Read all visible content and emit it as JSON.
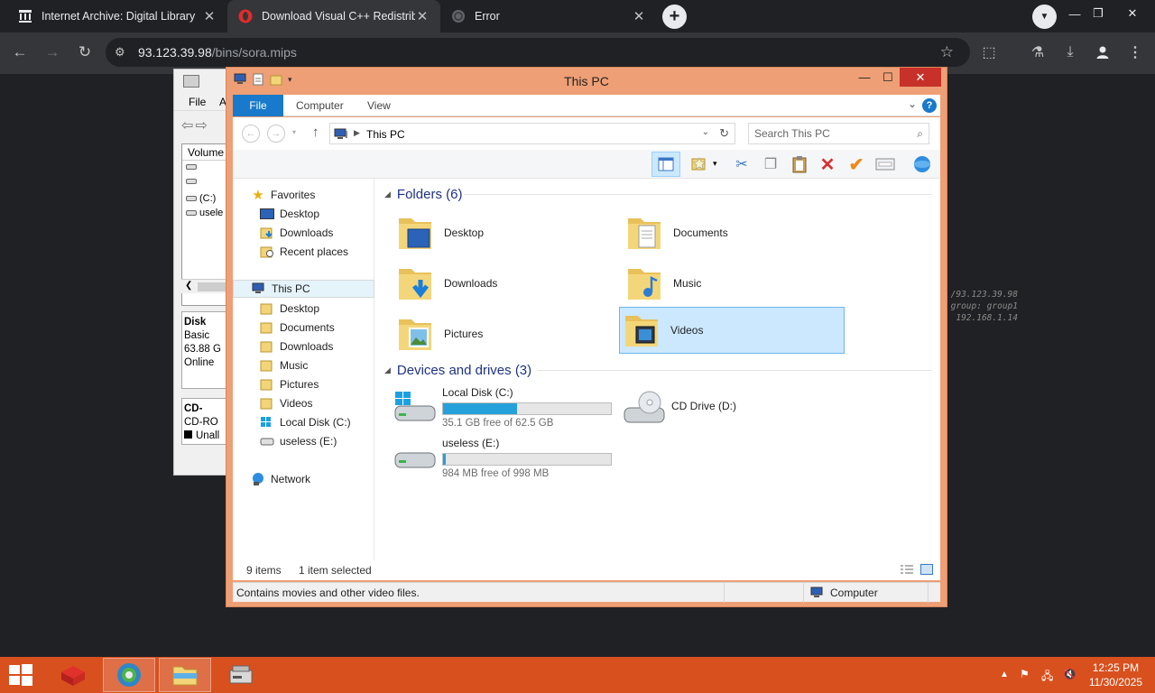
{
  "browser": {
    "tabs": [
      {
        "title": "Internet Archive: Digital Library",
        "favicon": "archive-icon"
      },
      {
        "title": "Download Visual C++ Redistrib",
        "favicon": "opera-icon"
      },
      {
        "title": "Error",
        "favicon": "globe-icon"
      }
    ],
    "address": {
      "host": "93.123.39.98",
      "path": "/bins/sora.mips"
    }
  },
  "page": {
    "ghost_lines": [
      "/93.123.39.98",
      "group: group1",
      "192.168.1.14"
    ]
  },
  "disk_management": {
    "menu": [
      "File",
      "A"
    ],
    "volume_header": "Volume",
    "volumes": [
      "",
      "",
      "(C:)",
      "usele"
    ],
    "disk0": [
      "Disk",
      "Basic",
      "63.88 G",
      "Online"
    ],
    "cd": [
      "CD-",
      "CD-RO",
      "Unall"
    ]
  },
  "explorer": {
    "title": "This PC",
    "ribbon_tabs": [
      "File",
      "Computer",
      "View"
    ],
    "address": "This PC",
    "search_placeholder": "Search This PC",
    "nav": {
      "favorites": "Favorites",
      "fav_items": [
        "Desktop",
        "Downloads",
        "Recent places"
      ],
      "this_pc": "This PC",
      "pc_items": [
        "Desktop",
        "Documents",
        "Downloads",
        "Music",
        "Pictures",
        "Videos",
        "Local Disk (C:)",
        "useless  (E:)"
      ],
      "network": "Network"
    },
    "folders_header": "Folders (6)",
    "folders": [
      "Desktop",
      "Documents",
      "Downloads",
      "Music",
      "Pictures",
      "Videos"
    ],
    "selected_folder": "Videos",
    "devices_header": "Devices and drives (3)",
    "drives": [
      {
        "name": "Local Disk (C:)",
        "free": "35.1 GB free of 62.5 GB",
        "used_fraction": 0.44
      },
      {
        "name": "CD Drive (D:)"
      },
      {
        "name": "useless  (E:)",
        "free": "984 MB free of 998 MB",
        "used_fraction": 0.014
      }
    ],
    "status": {
      "items": "9 items",
      "selected": "1 item selected"
    },
    "description": "Contains movies and other video files.",
    "location": "Computer",
    "accent": "#ee9f75"
  },
  "taskbar": {
    "time": "12:25 PM",
    "date": "11/30/2025",
    "color": "#d8501e"
  }
}
